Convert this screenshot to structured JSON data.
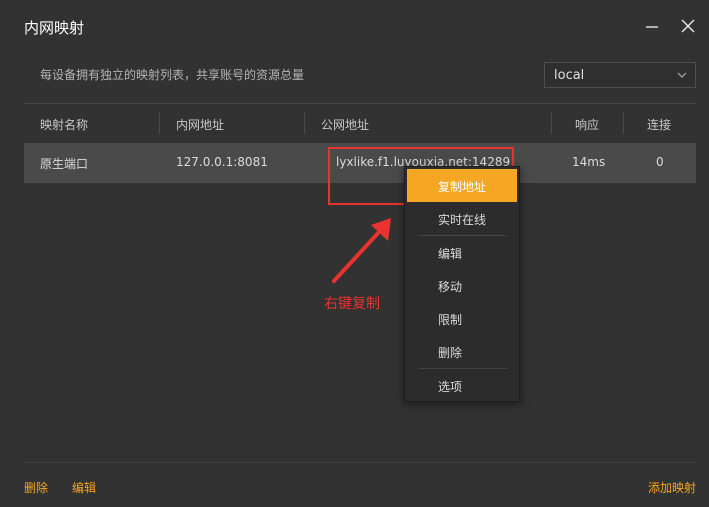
{
  "window": {
    "title": "内网映射"
  },
  "description": "每设备拥有独立的映射列表，共享账号的资源总量",
  "server_select": {
    "value": "local"
  },
  "table": {
    "columns": [
      "映射名称",
      "内网地址",
      "公网地址",
      "响应",
      "连接"
    ],
    "rows": [
      {
        "name": "原生端口",
        "local_addr": "127.0.0.1:8081",
        "public_addr": "lyxlike.f1.luyouxia.net:14289",
        "latency": "14ms",
        "connections": "0"
      }
    ]
  },
  "context_menu": {
    "items": [
      "复制地址",
      "实时在线",
      "编辑",
      "移动",
      "限制",
      "删除",
      "选项"
    ]
  },
  "annotation": {
    "text": "右键复制",
    "color": "#e8332e"
  },
  "footer": {
    "delete": "删除",
    "edit": "编辑",
    "add": "添加映射"
  },
  "colors": {
    "accent": "#f5a623",
    "background": "#323232",
    "row_selected": "#4a4a4a"
  }
}
